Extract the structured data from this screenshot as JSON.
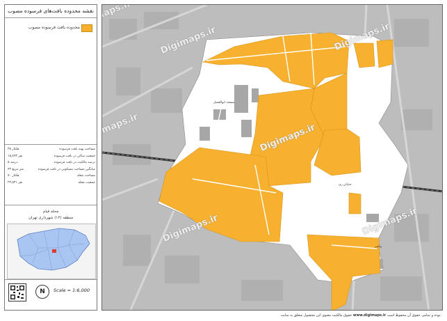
{
  "legend": {
    "title": "نقشه محدوده بافت‌های فرسوده مصوب",
    "swatch_label": "محدوده بافت فرسوده مصوب",
    "swatch_color": "#f7b12f",
    "stats": [
      {
        "label": "مساحت پهنه بافت فرسوده",
        "value": "۳۸ هکتار"
      },
      {
        "label": "جمعیت ساکن در بافت فرسوده",
        "value": "۱۵,۸۹۳ نفر"
      },
      {
        "label": "درصد مالکیت در بافت فرسوده",
        "value": "۵ درصد"
      },
      {
        "label": "میانگین مساحت مسکونی در بافت فرسوده",
        "value": "۴۳ متر مربع"
      },
      {
        "label": "مساحت محله",
        "value": "۷۰ هکتار"
      },
      {
        "label": "جمعیت محله",
        "value": "۲۳,۵۳۱ نفر"
      }
    ],
    "location_title": "محله قیام",
    "location_sub": "منطقه (۱۲) شهرداری تهران",
    "scale_prefix": "Scale = ",
    "scale_value": "1:6,000",
    "north_label": "N"
  },
  "watermarks": [
    "Digimaps.ir",
    "Digimaps.ir",
    "Digimaps.ir",
    "Digimaps.ir",
    "Digimaps.ir",
    "Digimaps.ir",
    "Digimaps.ir"
  ],
  "map_labels": [
    "مسجد ابوالفضل",
    "خیابان ری",
    "پیامبر"
  ],
  "footer": {
    "text_before": "حقوق مالکیت معنوی این محصول متعلق به سایت",
    "site": "www.digimaps.ir",
    "text_after": "بوده و تمامی حقوق آن محفوظ است."
  },
  "colors": {
    "decay_zone": "#f7b12f",
    "map_bg": "#b9b9b9",
    "study_area": "#ffffff"
  }
}
